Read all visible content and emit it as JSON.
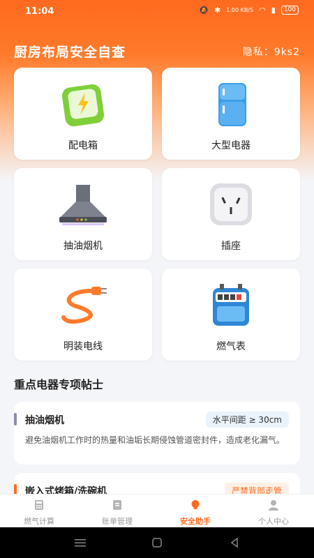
{
  "status_bar": {
    "time": "11:04",
    "net_speed": "1.00 KB/S",
    "battery": "100"
  },
  "header": {
    "title": "厨房布局安全自查",
    "privacy": "隐私：9ks2"
  },
  "cards": [
    {
      "label": "配电箱",
      "icon": "distribution-box-icon"
    },
    {
      "label": "大型电器",
      "icon": "refrigerator-icon"
    },
    {
      "label": "抽油烟机",
      "icon": "range-hood-icon"
    },
    {
      "label": "插座",
      "icon": "socket-icon"
    },
    {
      "label": "明装电线",
      "icon": "cable-icon"
    },
    {
      "label": "燃气表",
      "icon": "gas-meter-icon"
    }
  ],
  "section": {
    "title": "重点电器专项帖士"
  },
  "tips": [
    {
      "name": "抽油烟机",
      "badge": "水平间距 ≥ 30cm",
      "desc": "避免油烟机工作时的热量和油垢长期侵蚀管道密封件，造成老化漏气。",
      "bar_color": "#8a8fa8",
      "badge_bg": "#e9f3fb",
      "badge_color": "#333"
    },
    {
      "name": "嵌入式烤箱/洗碗机",
      "badge": "严禁背部走管",
      "desc": "",
      "bar_color": "#ff6a1f",
      "badge_bg": "#fff0e6",
      "badge_color": "#ff6a1f"
    }
  ],
  "tabs": [
    {
      "label": "燃气计算",
      "icon": "calculator-icon"
    },
    {
      "label": "账单管理",
      "icon": "bill-icon"
    },
    {
      "label": "安全助手",
      "icon": "bulb-icon"
    },
    {
      "label": "个人中心",
      "icon": "person-icon"
    }
  ],
  "colors": {
    "accent": "#ff6a1f",
    "tab_inactive": "#999999"
  }
}
